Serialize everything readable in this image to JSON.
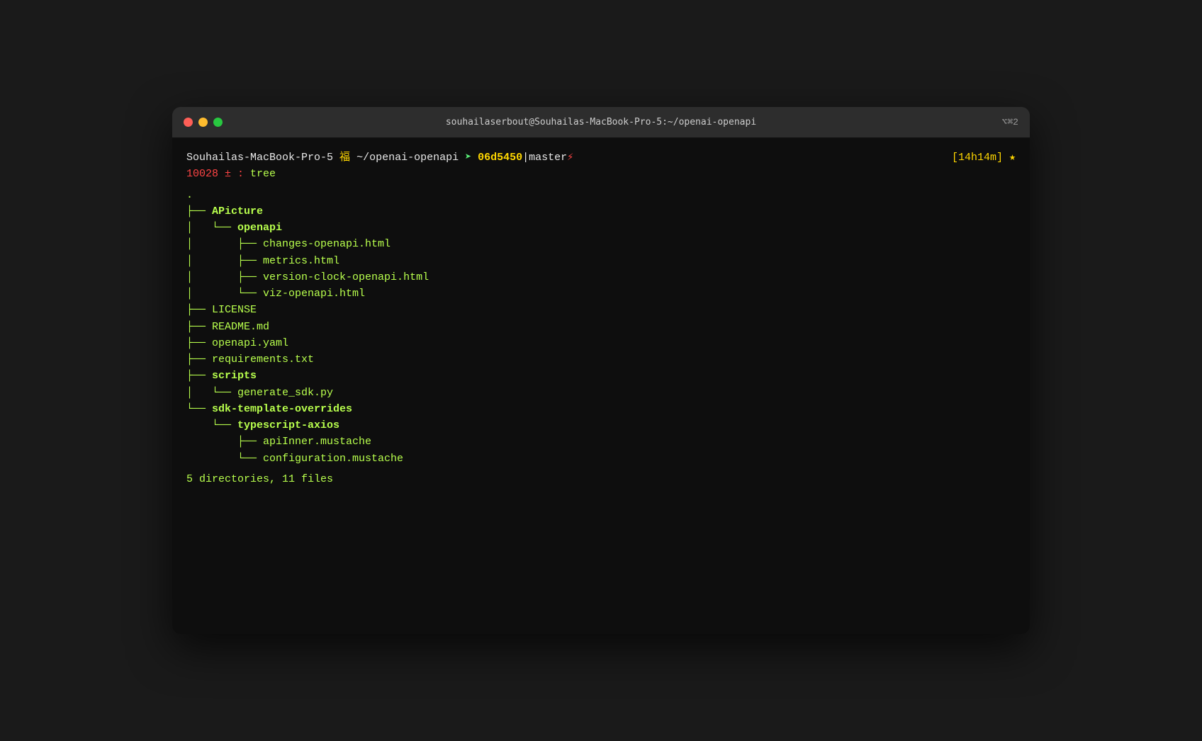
{
  "window": {
    "title": "souhailaserbout@Souhailas-MacBook-Pro-5:~/openai-openapi",
    "shortcut": "⌥⌘2",
    "traffic": {
      "close": "close",
      "minimize": "minimize",
      "maximize": "maximize"
    }
  },
  "terminal": {
    "prompt": {
      "host": "Souhailas-MacBook-Pro-5",
      "fuku": "福",
      "path": "~/openai-openapi",
      "arrow": "➤",
      "hash": "06d5450",
      "separator": "|",
      "branch": "master",
      "lightning": "⚡",
      "time": "[14h14m]",
      "star": "★"
    },
    "command": {
      "number": "10028 ± :",
      "text": "tree"
    },
    "tree": {
      "dot": ".",
      "summary": "5 directories, 11 files"
    }
  }
}
